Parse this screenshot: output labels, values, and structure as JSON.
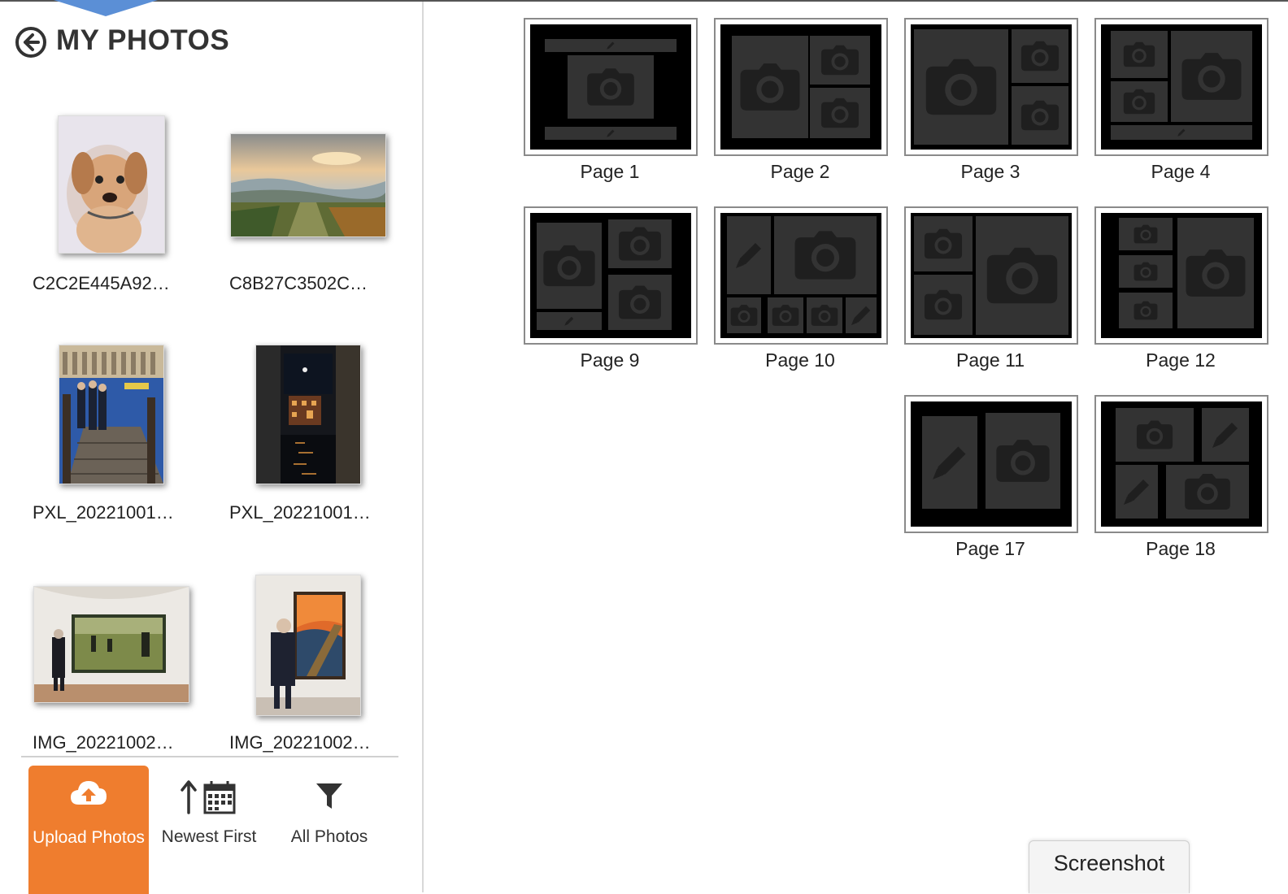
{
  "panel": {
    "title": "MY PHOTOS",
    "back_icon": "arrow-left-circle-icon"
  },
  "photos": [
    {
      "label": "C2C2E445A92…",
      "subject": "dog-watercolor"
    },
    {
      "label": "C8B27C3502C…",
      "subject": "vineyard-landscape"
    },
    {
      "label": "PXL_20221001…",
      "subject": "dock-venice"
    },
    {
      "label": "PXL_20221001…",
      "subject": "night-canal"
    },
    {
      "label": "IMG_20221002…",
      "subject": "museum-seurat"
    },
    {
      "label": "IMG_20221002…",
      "subject": "museum-scream"
    }
  ],
  "toolbar": {
    "upload_label": "Upload Photos",
    "sort_label": "Newest First",
    "filter_label": "All Photos",
    "upload_icon": "cloud-upload-icon",
    "sort_icon": "arrow-up-calendar-icon",
    "filter_icon": "funnel-icon",
    "accent": "#ef7d2e"
  },
  "pages": [
    {
      "label": "Page 1"
    },
    {
      "label": "Page 2"
    },
    {
      "label": "Page 3"
    },
    {
      "label": "Page 4"
    },
    {
      "label": "Page 9"
    },
    {
      "label": "Page 10"
    },
    {
      "label": "Page 11"
    },
    {
      "label": "Page 12"
    },
    {
      "label": "Page 17"
    },
    {
      "label": "Page 18"
    }
  ],
  "screenshot_button": {
    "label": "Screenshot"
  }
}
